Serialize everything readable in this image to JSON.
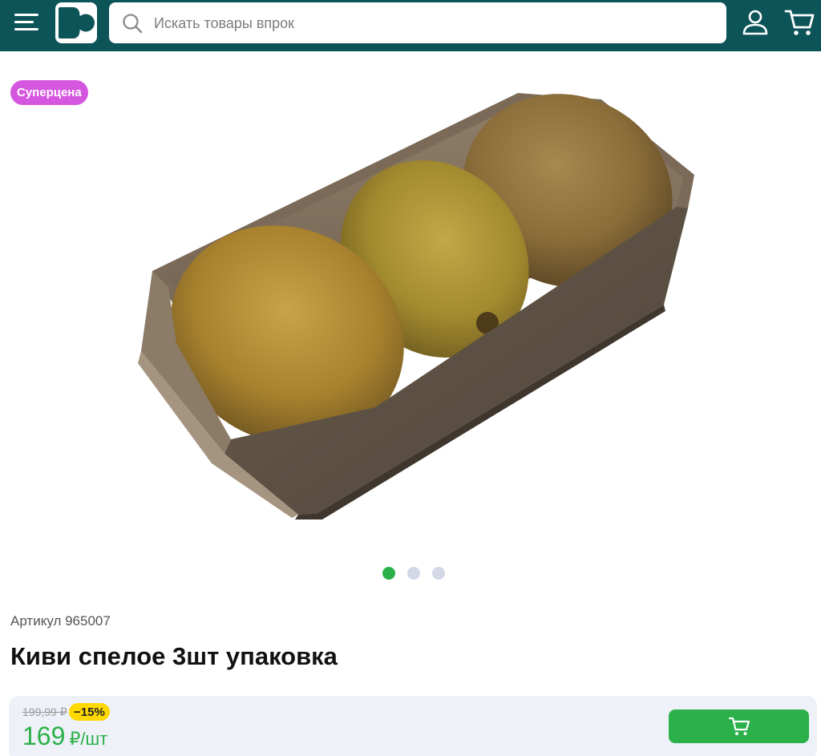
{
  "header": {
    "search": {
      "placeholder": "Искать товары впрок"
    },
    "icons": {
      "menu": "menu-icon",
      "logo": "store-logo",
      "search": "search-icon",
      "user": "user-icon",
      "cart": "cart-icon"
    }
  },
  "product": {
    "badge": "Суперцена",
    "gallery": {
      "count": 3,
      "active_index": 0
    },
    "sku": "Артикул 965007",
    "title": "Киви спелое 3шт упаковка"
  },
  "price": {
    "old": "199,99 ₽",
    "discount": "−15%",
    "current": "169",
    "unit": "₽/шт"
  },
  "colors": {
    "header_bg": "#0d5458",
    "accent_green": "#2bb04a",
    "badge_purple": "#d657df",
    "discount_yellow": "#ffd800",
    "price_bar_bg": "#eef1f7"
  }
}
